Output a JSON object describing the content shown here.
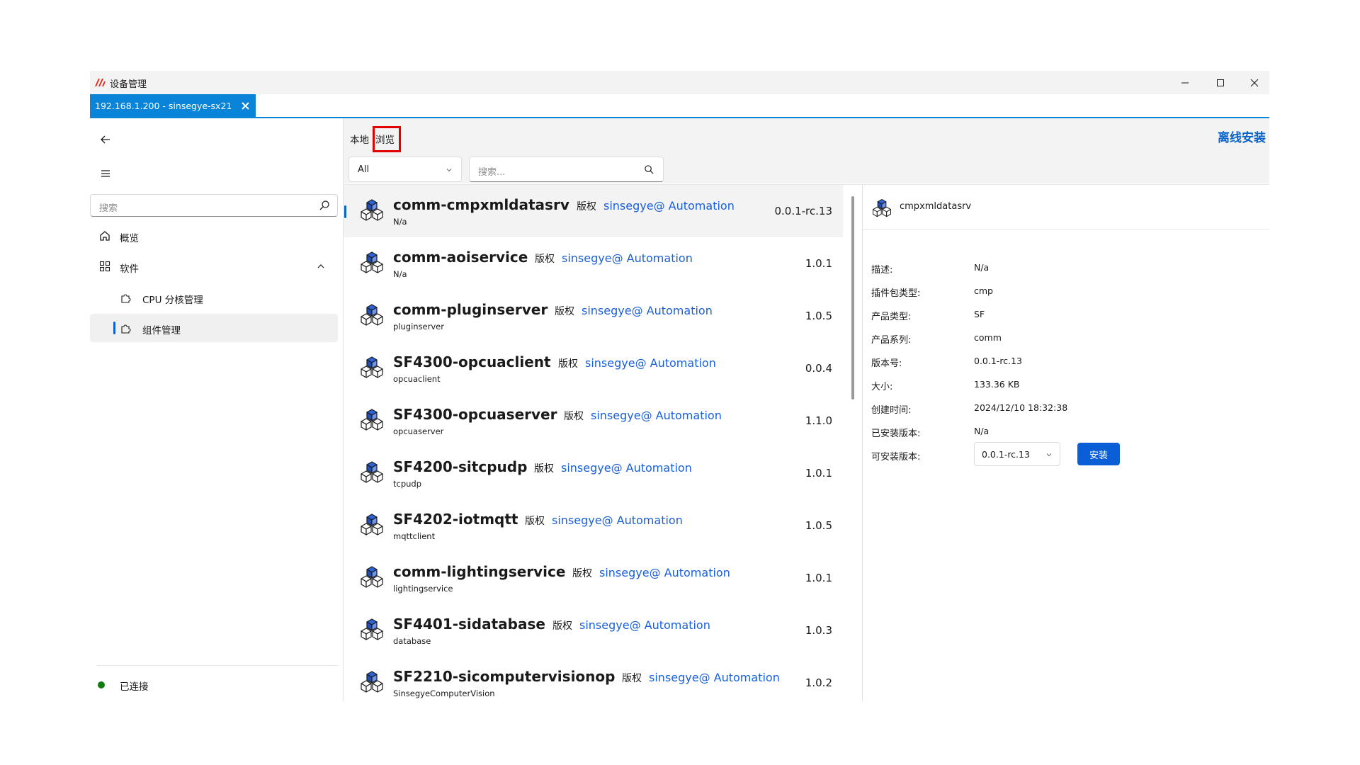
{
  "window": {
    "title": "设备管理",
    "accent_color": "#0a84d8",
    "controls": [
      "minimize-icon",
      "maximize-icon",
      "close-icon"
    ]
  },
  "connection_tab": {
    "label": "192.168.1.200 - sinsegye-sx21",
    "close_icon": "close-icon"
  },
  "sidebar": {
    "search_placeholder": "搜索",
    "items": [
      {
        "label": "概览",
        "icon": "home-icon"
      },
      {
        "label": "软件",
        "icon": "apps-icon",
        "expanded": true
      },
      {
        "label": "CPU 分核管理",
        "icon": "puzzle-icon"
      },
      {
        "label": "组件管理",
        "icon": "puzzle-icon",
        "selected": true
      }
    ],
    "status": {
      "label": "已连接",
      "color": "#107c10"
    }
  },
  "main": {
    "tabs": [
      {
        "label": "本地"
      },
      {
        "label": "浏览",
        "active": true
      }
    ],
    "offline_install": "离线安装",
    "filter": {
      "selected": "All",
      "search_placeholder": "搜索..."
    },
    "packages": [
      {
        "name": "comm-cmpxmldatasrv",
        "rights": "版权",
        "author": "sinsegye@ Automation",
        "sub": "N/a",
        "version": "0.0.1-rc.13",
        "selected": true
      },
      {
        "name": "comm-aoiservice",
        "rights": "版权",
        "author": "sinsegye@ Automation",
        "sub": "N/a",
        "version": "1.0.1"
      },
      {
        "name": "comm-pluginserver",
        "rights": "版权",
        "author": "sinsegye@ Automation",
        "sub": "pluginserver",
        "version": "1.0.5"
      },
      {
        "name": "SF4300-opcuaclient",
        "rights": "版权",
        "author": "sinsegye@ Automation",
        "sub": "opcuaclient",
        "version": "0.0.4"
      },
      {
        "name": "SF4300-opcuaserver",
        "rights": "版权",
        "author": "sinsegye@ Automation",
        "sub": "opcuaserver",
        "version": "1.1.0"
      },
      {
        "name": "SF4200-sitcpudp",
        "rights": "版权",
        "author": "sinsegye@ Automation",
        "sub": "tcpudp",
        "version": "1.0.1"
      },
      {
        "name": "SF4202-iotmqtt",
        "rights": "版权",
        "author": "sinsegye@ Automation",
        "sub": "mqttclient",
        "version": "1.0.5"
      },
      {
        "name": "comm-lightingservice",
        "rights": "版权",
        "author": "sinsegye@ Automation",
        "sub": "lightingservice",
        "version": "1.0.1"
      },
      {
        "name": "SF4401-sidatabase",
        "rights": "版权",
        "author": "sinsegye@ Automation",
        "sub": "database",
        "version": "1.0.3"
      },
      {
        "name": "SF2210-sicomputervisionop",
        "rights": "版权",
        "author": "sinsegye@ Automation",
        "sub": "SinsegyeComputerVision",
        "version": "1.0.2"
      }
    ]
  },
  "detail": {
    "title": "cmpxmldatasrv",
    "rows": [
      {
        "label": "描述:",
        "value": "N/a"
      },
      {
        "label": "插件包类型:",
        "value": "cmp"
      },
      {
        "label": "产品类型:",
        "value": "SF"
      },
      {
        "label": "产品系列:",
        "value": "comm"
      },
      {
        "label": "版本号:",
        "value": "0.0.1-rc.13"
      },
      {
        "label": "大小:",
        "value": "133.36 KB"
      },
      {
        "label": "创建时间:",
        "value": "2024/12/10 18:32:38"
      },
      {
        "label": "已安装版本:",
        "value": "N/a"
      },
      {
        "label": "可安装版本:",
        "value": ""
      }
    ],
    "installable_version": "0.0.1-rc.13",
    "install_button": "安装"
  }
}
